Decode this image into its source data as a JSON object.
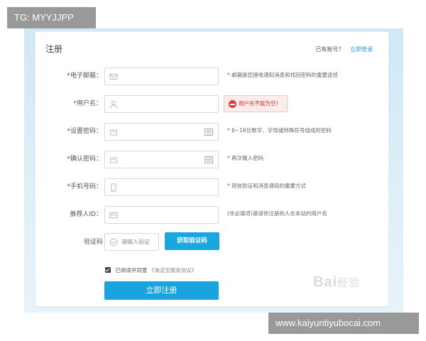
{
  "overlay": {
    "top_tag": "TG: MYYJJPP",
    "bottom_tag": "www.kaiyuntiyubocai.com",
    "watermark_brand": "Bai",
    "watermark_cn": "经验"
  },
  "form": {
    "title": "注册",
    "login_prompt": "已有账号？",
    "login_link": "立即登录",
    "fields": [
      {
        "label": "*电子邮箱：",
        "icon": "email-icon",
        "hint": "* 邮箱是您接收通知消息和找回密码的重要途径"
      },
      {
        "label": "*用户名：",
        "icon": "user-icon",
        "error": "用户名不能为空！"
      },
      {
        "label": "*设置密码：",
        "icon": "lock-icon",
        "hint": "* 6~16位数字、字母或特殊符号组成的密码"
      },
      {
        "label": "*确认密码：",
        "icon": "lock-icon",
        "hint": "* 再次输入密码"
      },
      {
        "label": "*手机号码：",
        "icon": "phone-icon",
        "hint": "* 短信验证和消息通知的重要方式"
      },
      {
        "label": "推荐人ID：",
        "icon": "id-card-icon",
        "hint": "(非必填项)邀请你注册的人在本站的用户名"
      }
    ],
    "captcha": {
      "label": "验证码",
      "placeholder": "请输入验证",
      "button": "获取验证码"
    },
    "agree": {
      "text": "已阅读并同意",
      "agreement": "《淘淀宝服务协议》"
    },
    "submit": "立即注册"
  },
  "colors": {
    "accent": "#19a3df",
    "link": "#2b93d6",
    "error": "#d9262c"
  }
}
